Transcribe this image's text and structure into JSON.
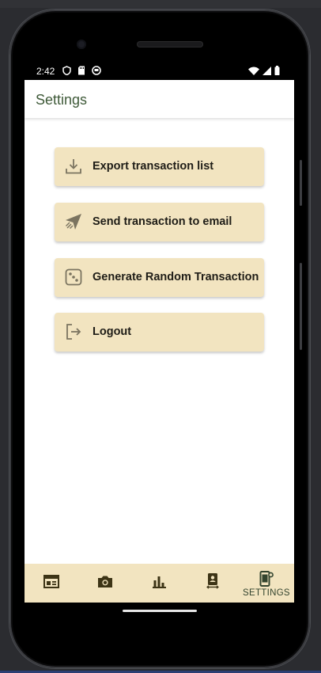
{
  "status_bar": {
    "time": "2:42",
    "left_icons": [
      "shield-icon",
      "sd-card-icon",
      "circle-face-icon"
    ],
    "right_icons": [
      "wifi-icon",
      "signal-icon",
      "battery-icon"
    ]
  },
  "app_bar": {
    "title": "Settings"
  },
  "settings_menu": {
    "items": [
      {
        "label": "Export transaction list",
        "icon": "download-icon"
      },
      {
        "label": "Send transaction to email",
        "icon": "send-icon"
      },
      {
        "label": "Generate Random Transaction",
        "icon": "dice-icon"
      },
      {
        "label": "Logout",
        "icon": "logout-icon"
      }
    ]
  },
  "bottom_nav": {
    "items": [
      {
        "icon": "calendar-table-icon",
        "label": ""
      },
      {
        "icon": "camera-icon",
        "label": ""
      },
      {
        "icon": "bar-chart-icon",
        "label": ""
      },
      {
        "icon": "book-transfer-icon",
        "label": ""
      },
      {
        "icon": "phone-settings-icon",
        "label": "SETTINGS"
      }
    ],
    "active_index": 4
  },
  "colors": {
    "accent_title": "#3f5a39",
    "button_bg": "#f2e4c0",
    "nav_bg": "#f2e4c0",
    "icon": "#7b7460",
    "nav_icon": "#3d3416"
  }
}
